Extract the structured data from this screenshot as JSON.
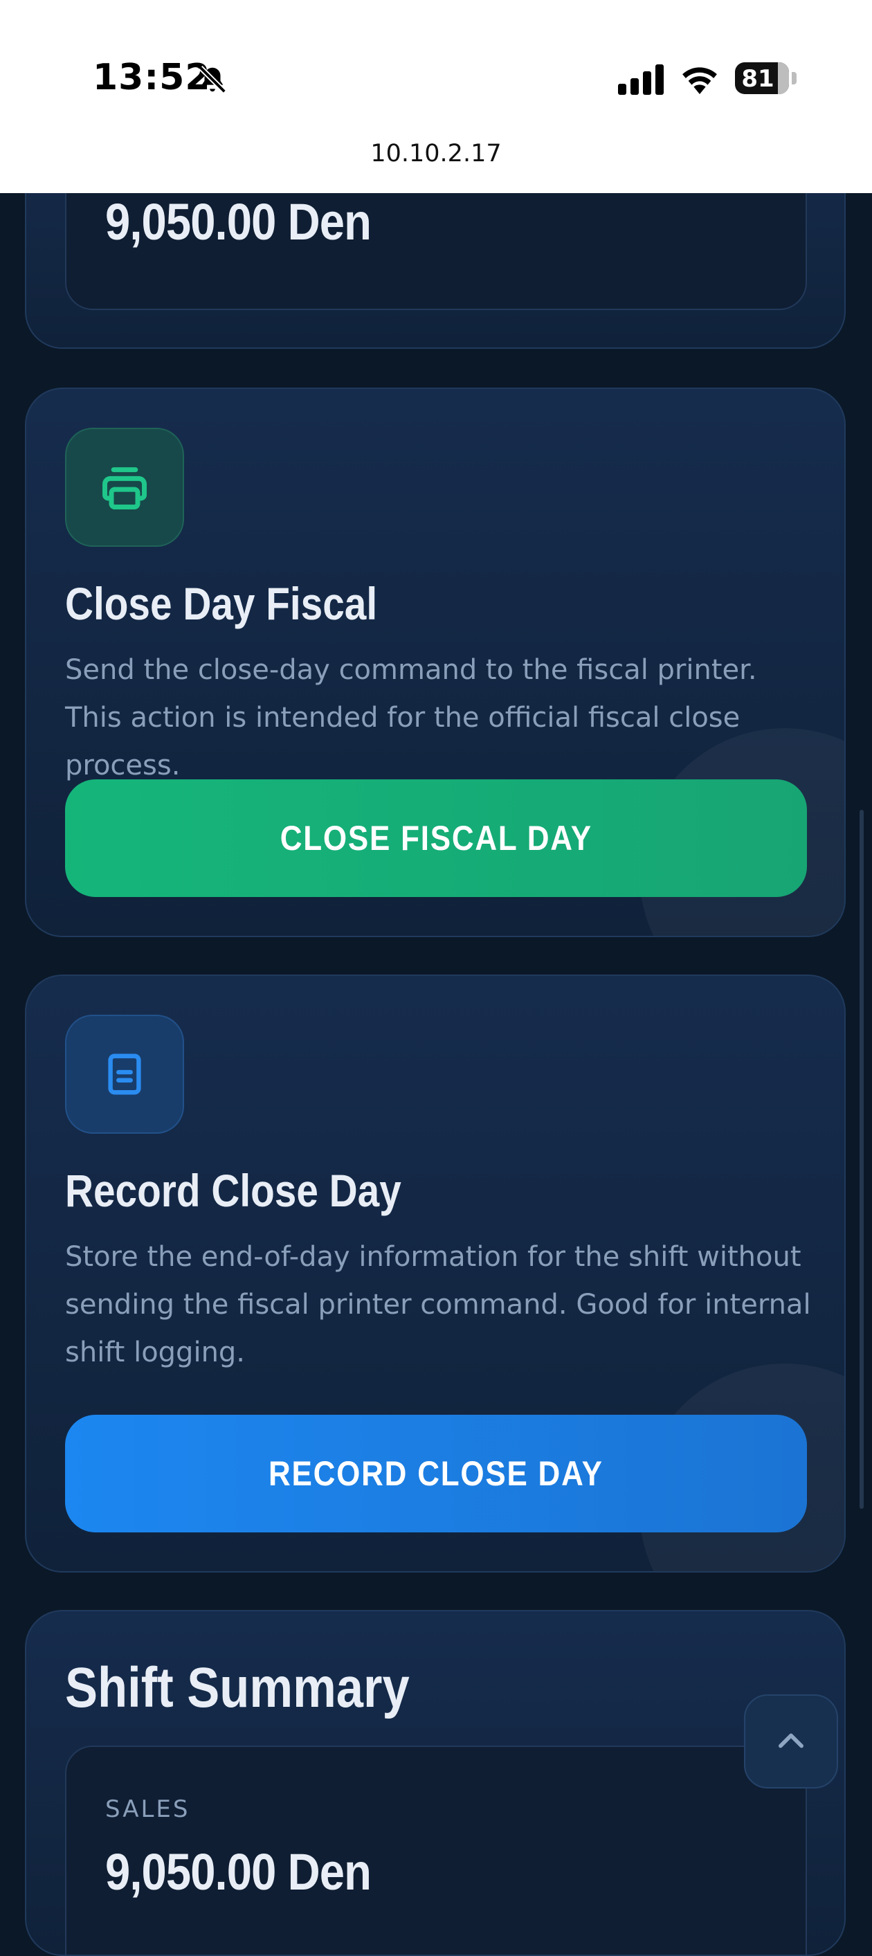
{
  "status_bar": {
    "time": "13:52",
    "battery": "81",
    "url": "10.10.2.17"
  },
  "top_card": {
    "amount": "9,050.00 Den"
  },
  "fiscal_card": {
    "icon": "printer-icon",
    "title": "Close Day Fiscal",
    "description": "Send the close-day command to the fiscal printer. This action is intended for the official fiscal close process.",
    "button_label": "CLOSE FISCAL DAY"
  },
  "record_card": {
    "icon": "document-icon",
    "title": "Record Close Day",
    "description": "Store the end-of-day information for the shift without sending the fiscal printer command. Good for internal shift logging.",
    "button_label": "RECORD CLOSE DAY"
  },
  "shift_summary": {
    "title": "Shift Summary",
    "sales_label": "SALES",
    "sales_amount": "9,050.00 Den"
  },
  "colors": {
    "background": "#0b1828",
    "accent_green": "#15b57a",
    "accent_blue": "#1c87f0"
  }
}
